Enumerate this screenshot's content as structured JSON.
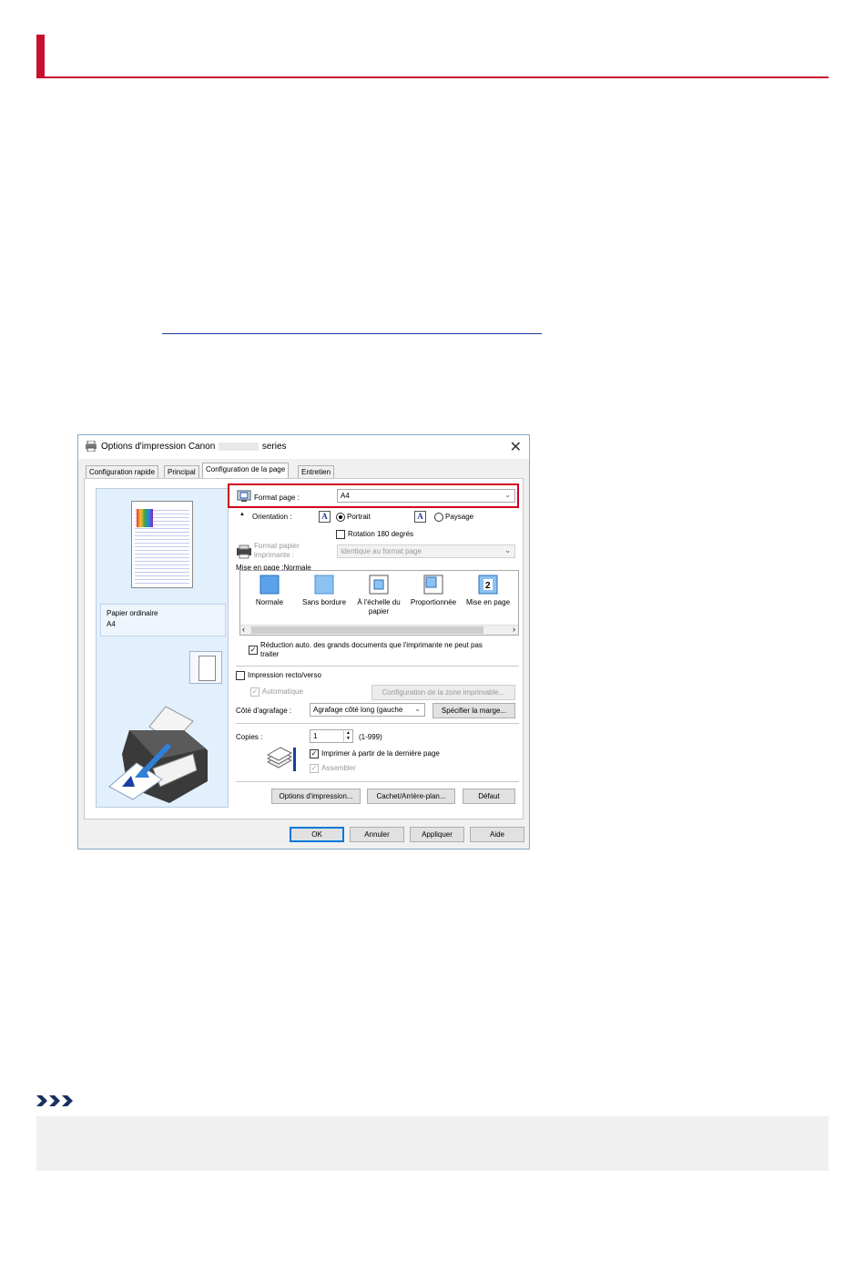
{
  "dialog": {
    "title_prefix": "Options d'impression Canon",
    "title_suffix": "series",
    "close": "✕",
    "tabs": [
      "Configuration rapide",
      "Principal",
      "Configuration de la page",
      "Entretien"
    ],
    "media": {
      "line1": "Papier ordinaire",
      "line2": "A4"
    },
    "page_size": {
      "label": "Format page :",
      "value": "A4"
    },
    "orientation": {
      "label": "Orientation :",
      "portrait": "Portrait",
      "landscape": "Paysage",
      "selected": "Portrait"
    },
    "rotate": {
      "label": "Rotation 180 degrés",
      "checked": false
    },
    "printer_paper": {
      "label1": "Format papier",
      "label2": "imprimante :",
      "value": "Identique au format page"
    },
    "layout": {
      "label": "Mise en page :Normale",
      "items": [
        {
          "label1": "Normale",
          "label2": ""
        },
        {
          "label1": "Sans bordure",
          "label2": ""
        },
        {
          "label1": "À l'échelle du",
          "label2": "papier"
        },
        {
          "label1": "Proportionnée",
          "label2": ""
        },
        {
          "label1": "Mise en page",
          "label2": ""
        }
      ],
      "scroll_left": "‹",
      "scroll_right": "›"
    },
    "auto_reduce": {
      "line1": "Réduction auto. des grands documents que l'imprimante ne peut pas",
      "line2": "traiter",
      "checked": true
    },
    "duplex": {
      "label": "Impression recto/verso",
      "checked": false
    },
    "automatic": {
      "label": "Automatique",
      "checked": true,
      "enabled": false
    },
    "print_area_button": "Configuration de la zone imprimable...",
    "stapling": {
      "label": "Côté d'agrafage :",
      "value": "Agrafage côté long (gauche",
      "margin_button": "Spécifier la marge..."
    },
    "copies": {
      "label": "Copies :",
      "value": "1",
      "range": "(1-999)"
    },
    "last_page": {
      "label": "Imprimer à partir de la dernière page",
      "checked": true
    },
    "collate": {
      "label": "Assembler",
      "checked": true,
      "enabled": false
    },
    "bottom_buttons": [
      "Options d'impression...",
      "Cachet/Arrière-plan...",
      "Défaut"
    ],
    "footer_buttons": [
      "OK",
      "Annuler",
      "Appliquer",
      "Aide"
    ]
  },
  "colors": {
    "accent": "#c8102e",
    "highlight": "#d0021b",
    "link": "#1a3e9e"
  }
}
